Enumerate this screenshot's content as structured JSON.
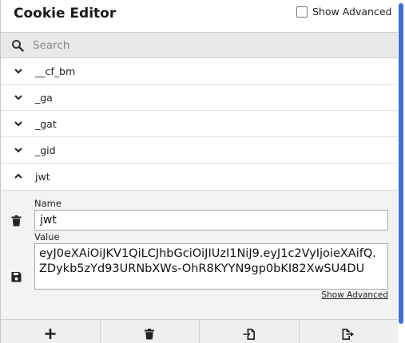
{
  "header": {
    "title": "Cookie Editor",
    "show_advanced_label": "Show Advanced"
  },
  "search": {
    "placeholder": "Search",
    "value": ""
  },
  "cookies": [
    {
      "name": "__cf_bm",
      "expanded": false
    },
    {
      "name": "_ga",
      "expanded": false
    },
    {
      "name": "_gat",
      "expanded": false
    },
    {
      "name": "_gid",
      "expanded": false
    },
    {
      "name": "jwt",
      "expanded": true
    }
  ],
  "editor": {
    "name_label": "Name",
    "name_value": "jwt",
    "value_label": "Value",
    "value_text": "eyJ0eXAiOiJKV1QiLCJhbGciOiJIUzI1NiJ9.eyJ1c2VyIjoieXAifQ.ZDykb5zYd93URNbXWs-OhR8KYYN9gp0bKI82XwSU4DU",
    "show_advanced_link": "Show Advanced"
  },
  "toolbar": {
    "icons": [
      "plus-icon",
      "trash-icon",
      "import-icon",
      "export-icon"
    ]
  },
  "colors": {
    "scrollbar_thumb": "#3d6fd6",
    "search_bg": "#e9e9e9",
    "detail_bg": "#f3f3f3"
  }
}
